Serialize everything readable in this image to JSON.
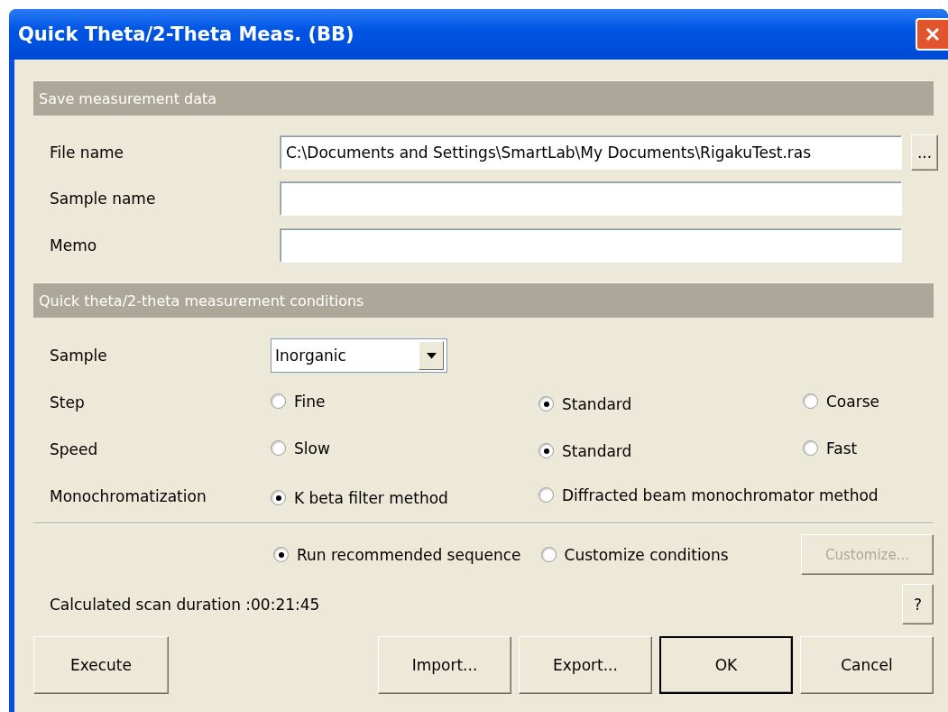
{
  "window": {
    "title": "Quick Theta/2-Theta Meas. (BB)"
  },
  "save_section": {
    "title": "Save measurement data",
    "fields": [
      {
        "label": "File name",
        "value": "C:\\Documents and Settings\\SmartLab\\My Documents\\RigakuTest.ras",
        "kind": "browse",
        "browse_label": "..."
      },
      {
        "label": "Sample name",
        "kind": "text"
      },
      {
        "label": "Memo",
        "kind": "text"
      }
    ]
  },
  "conditions_section": {
    "title": "Quick theta/2-theta measurement conditions",
    "sample": {
      "label": "Sample",
      "value": "Inorganic"
    },
    "options": [
      {
        "label": "Step",
        "choices": [
          {
            "label": "Fine",
            "selected": false
          },
          {
            "label": "Standard",
            "selected": true
          },
          {
            "label": "Coarse",
            "selected": false
          }
        ]
      },
      {
        "label": "Speed",
        "choices": [
          {
            "label": "Slow",
            "selected": false
          },
          {
            "label": "Standard",
            "selected": true
          },
          {
            "label": "Fast",
            "selected": false
          }
        ]
      },
      {
        "label": "Monochromatization",
        "choices": [
          {
            "label": "K beta filter method",
            "selected": true
          },
          {
            "label": "Diffracted beam monochromator method",
            "selected": false
          }
        ]
      }
    ]
  },
  "mode": {
    "choices": [
      {
        "label": "Run recommended sequence",
        "selected": true
      },
      {
        "label": "Customize conditions",
        "selected": false
      }
    ],
    "customize_button": {
      "label": "Customize...",
      "disabled": true
    }
  },
  "duration": "Calculated scan duration :00:21:45",
  "help_button": "?",
  "left_buttons": [
    {
      "label": "Execute",
      "default": false
    }
  ],
  "right_buttons": [
    {
      "label": "Import...",
      "default": false
    },
    {
      "label": "Export...",
      "default": false
    },
    {
      "label": "OK",
      "default": true
    },
    {
      "label": "Cancel",
      "default": false
    }
  ]
}
